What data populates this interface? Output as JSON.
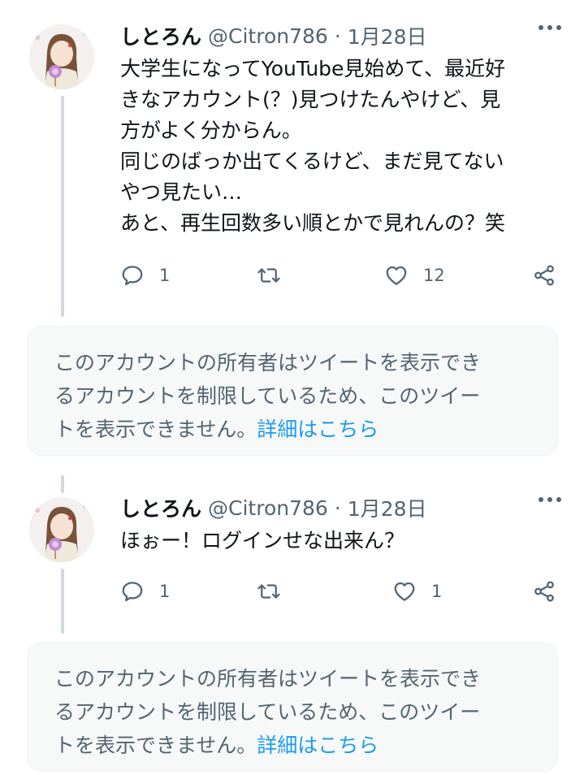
{
  "tweets": [
    {
      "name": "しとろん",
      "handle": "@Citron786",
      "separator": "·",
      "date": "1月28日",
      "text": "大学生になってYouTube見始めて、最近好\nきなアカウント(？)見つけたんやけど、見\n方がよく分からん。\n同じのばっか出てくるけど、まだ見てない\nやつ見たい…\nあと、再生回数多い順とかで見れんの？笑",
      "reply_count": "1",
      "retweet_count": "",
      "like_count": "12"
    },
    {
      "name": "しとろん",
      "handle": "@Citron786",
      "separator": "·",
      "date": "1月28日",
      "text": "ほぉー！ログインせな出来ん？",
      "reply_count": "1",
      "retweet_count": "",
      "like_count": "1"
    }
  ],
  "notice": {
    "message": "このアカウントの所有者はツイートを表示でき\nるアカウントを制限しているため、このツイー\nトを表示できません。",
    "link": "詳細はこちら"
  },
  "colors": {
    "text": "#0f1419",
    "secondary": "#536471",
    "link": "#1d9bf0",
    "notice_bg": "#f7f9f9",
    "thread_line": "#cfd9de"
  },
  "icons": [
    "avatar",
    "more-icon",
    "reply-icon",
    "retweet-icon",
    "like-icon",
    "share-icon"
  ]
}
